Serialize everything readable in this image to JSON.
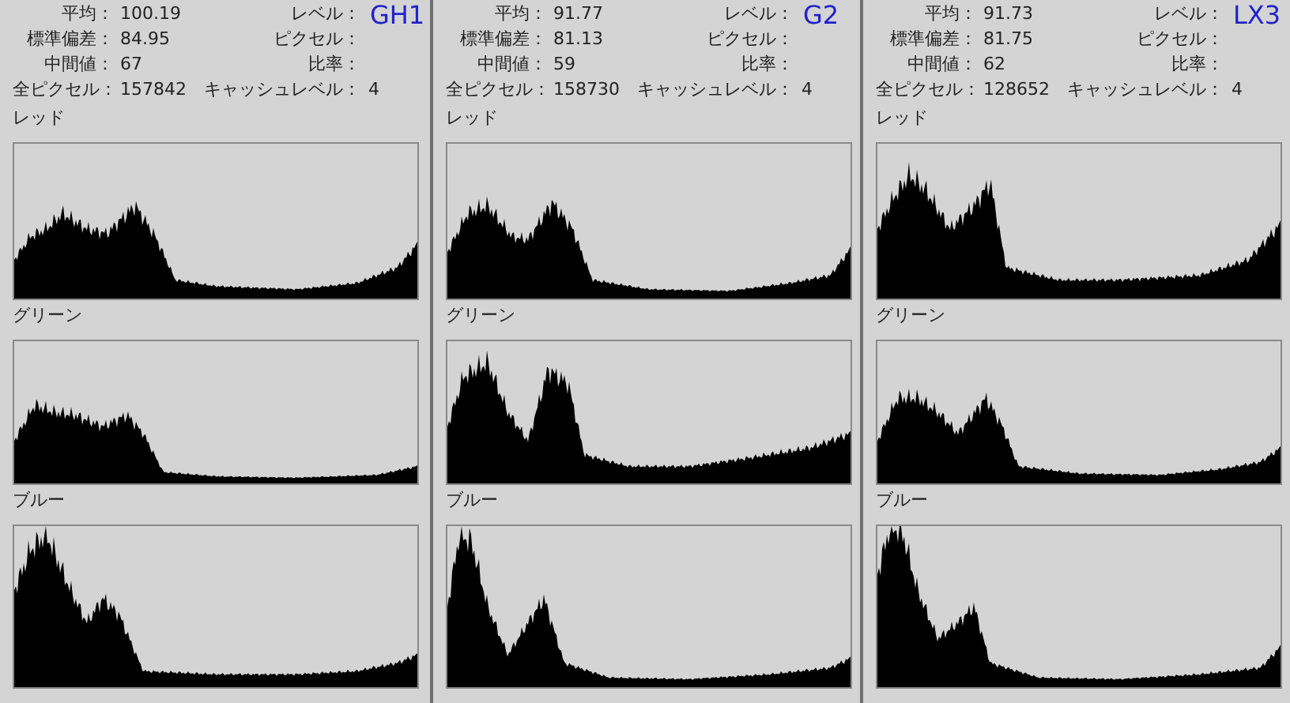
{
  "panels": [
    {
      "stats": [
        {
          "label": "平均：",
          "value": "100.19"
        },
        {
          "label": "標準偏差：",
          "value": "84.95"
        },
        {
          "label": "中間値：",
          "value": "67"
        },
        {
          "label": "全ピクセル：",
          "value": "157842"
        }
      ],
      "right_stats": [
        {
          "label": "レベル："
        },
        {
          "label": "ピクセル："
        },
        {
          "label": "比率："
        },
        {
          "label": "キャッシュレベル：",
          "value": "4"
        }
      ],
      "camera": "GH1",
      "channels": [
        {
          "label": "レッド"
        },
        {
          "label": "グリーン"
        },
        {
          "label": "ブルー"
        }
      ]
    },
    {
      "stats": [
        {
          "label": "平均：",
          "value": "91.77"
        },
        {
          "label": "標準偏差：",
          "value": "81.13"
        },
        {
          "label": "中間値：",
          "value": "59"
        },
        {
          "label": "全ピクセル：",
          "value": "158730"
        }
      ],
      "right_stats": [
        {
          "label": "レベル："
        },
        {
          "label": "ピクセル："
        },
        {
          "label": "比率："
        },
        {
          "label": "キャッシュレベル：",
          "value": "4"
        }
      ],
      "camera": "G2",
      "channels": [
        {
          "label": "レッド"
        },
        {
          "label": "グリーン"
        },
        {
          "label": "ブルー"
        }
      ]
    },
    {
      "stats": [
        {
          "label": "平均：",
          "value": "91.73"
        },
        {
          "label": "標準偏差：",
          "value": "81.75"
        },
        {
          "label": "中間値：",
          "value": "62"
        },
        {
          "label": "全ピクセル：",
          "value": "128652"
        }
      ],
      "right_stats": [
        {
          "label": "レベル："
        },
        {
          "label": "ピクセル："
        },
        {
          "label": "比率："
        },
        {
          "label": "キャッシュレベル：",
          "value": "4"
        }
      ],
      "camera": "LX3",
      "channels": [
        {
          "label": "レッド"
        },
        {
          "label": "グリーン"
        },
        {
          "label": "ブルー"
        }
      ]
    }
  ]
}
